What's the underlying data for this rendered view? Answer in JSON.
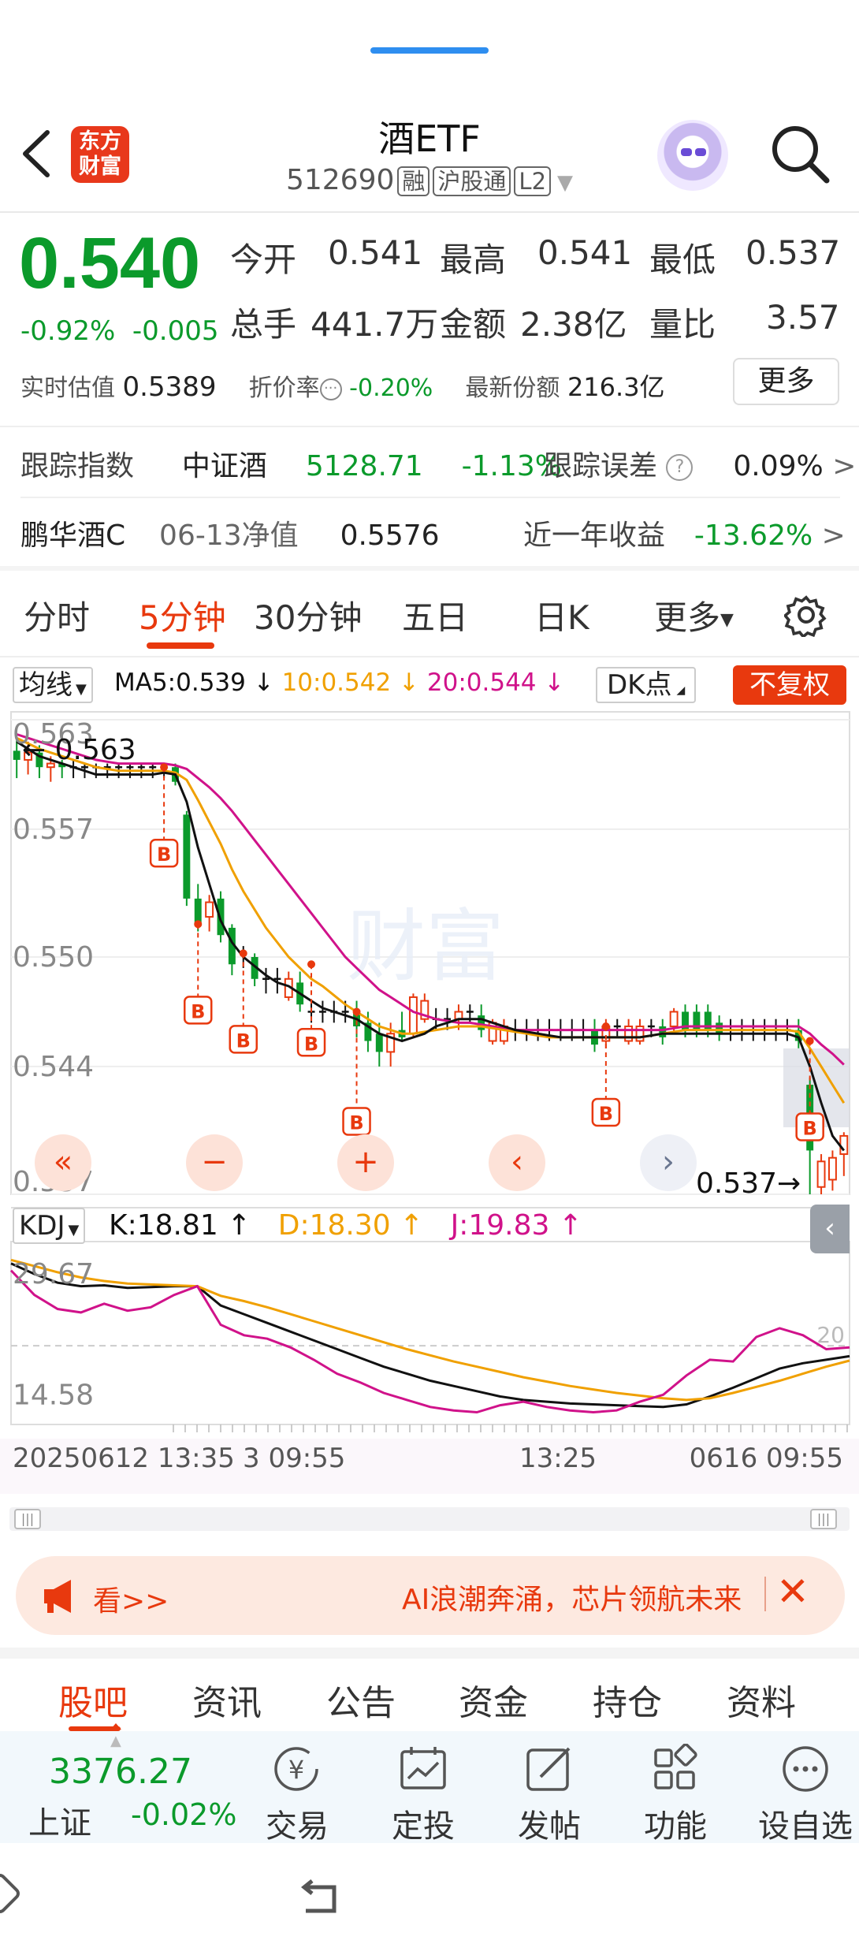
{
  "header": {
    "title": "酒ETF",
    "code": "512690",
    "tags": [
      "融",
      "沪股通",
      "L2"
    ],
    "logo_line1": "东方",
    "logo_line2": "财富"
  },
  "quote": {
    "price": "0.540",
    "change_pct": "-0.92%",
    "change_abs": "-0.005",
    "open_label": "今开",
    "open": "0.541",
    "high_label": "最高",
    "high": "0.541",
    "low_label": "最低",
    "low": "0.537",
    "volume_label": "总手",
    "volume": "441.7万",
    "amount_label": "金额",
    "amount": "2.38亿",
    "ratio_label": "量比",
    "ratio": "3.57",
    "est_label": "实时估值",
    "est_value": "0.5389",
    "discount_label": "折价率",
    "discount_value": "-0.20%",
    "shares_label": "最新份额",
    "shares_value": "216.3亿",
    "more_label": "更多"
  },
  "tracking": {
    "label": "跟踪指数",
    "index_name": "中证酒",
    "index_value": "5128.71",
    "index_change": "-1.13%",
    "error_label": "跟踪误差",
    "error_value": "0.09%",
    "arrow": ">"
  },
  "fund": {
    "name": "鹏华酒C",
    "nav_label": "06-13净值",
    "nav_value": "0.5576",
    "year_label": "近一年收益",
    "year_value": "-13.62%",
    "arrow": ">"
  },
  "tabs": [
    "分时",
    "5分钟",
    "30分钟",
    "五日",
    "日K",
    "更多"
  ],
  "chart_toolbar": {
    "ma_dropdown": "均线",
    "ma5": "MA5:0.539 ↓",
    "ma10": "10:0.542 ↓",
    "ma20": "20:0.544 ↓",
    "dk_label": "DK点",
    "adjust_label": "不复权"
  },
  "chart": {
    "y_ticks": [
      "0.563",
      "0.557",
      "0.550",
      "0.544",
      "0.537"
    ],
    "high_marker": "← 0.563",
    "low_marker": "0.537→",
    "buy_marker": "B",
    "nav_buttons": [
      "«",
      "−",
      "+",
      "‹",
      "›"
    ]
  },
  "kdj": {
    "dropdown": "KDJ",
    "k": "K:18.81 ↑",
    "d": "D:18.30 ↑",
    "j": "J:19.83 ↑",
    "y_ticks": [
      "29.67",
      "14.58"
    ],
    "ref_level": "20"
  },
  "time_axis": [
    "20250612 13:35",
    "3 09:55",
    "13:25",
    "0616 09:55"
  ],
  "banner": {
    "left_text": "看>>",
    "text": "AI浪潮奔涌，芯片领航未来"
  },
  "bottom_tabs": [
    "股吧",
    "资讯",
    "公告",
    "资金",
    "持仓",
    "资料"
  ],
  "bottom_bar": {
    "index_value": "3376.27",
    "index_name": "上证",
    "index_change": "-0.02%",
    "items": [
      "交易",
      "定投",
      "发帖",
      "功能",
      "设自选"
    ]
  },
  "colors": {
    "up": "#e8390e",
    "down": "#0b9a2b",
    "ma5": "#111111",
    "ma10": "#f0a000",
    "ma20": "#d0128a",
    "accent": "#e8390e",
    "link_blue": "#2e8ef0"
  },
  "chart_data": [
    {
      "type": "candlestick",
      "title": "",
      "ylim": [
        0.537,
        0.563
      ],
      "y_ticks": [
        0.563,
        0.557,
        0.55,
        0.544,
        0.537
      ],
      "candles": [
        {
          "o": 0.5613,
          "c": 0.5608,
          "h": 0.562,
          "l": 0.5598
        },
        {
          "o": 0.5608,
          "c": 0.5612,
          "h": 0.5618,
          "l": 0.56
        },
        {
          "o": 0.5612,
          "c": 0.5604,
          "h": 0.5616,
          "l": 0.5598
        },
        {
          "o": 0.5604,
          "c": 0.5606,
          "h": 0.561,
          "l": 0.5596
        },
        {
          "o": 0.5606,
          "c": 0.5604,
          "h": 0.5608,
          "l": 0.5598
        },
        {
          "o": 0.5604,
          "c": 0.5604,
          "h": 0.5608,
          "l": 0.5598
        },
        {
          "o": 0.5604,
          "c": 0.5604,
          "h": 0.5606,
          "l": 0.5598
        },
        {
          "o": 0.5604,
          "c": 0.5604,
          "h": 0.5606,
          "l": 0.5598
        },
        {
          "o": 0.5604,
          "c": 0.5604,
          "h": 0.5606,
          "l": 0.5598
        },
        {
          "o": 0.5604,
          "c": 0.5604,
          "h": 0.5606,
          "l": 0.5598
        },
        {
          "o": 0.5604,
          "c": 0.5604,
          "h": 0.5606,
          "l": 0.5598
        },
        {
          "o": 0.5604,
          "c": 0.5604,
          "h": 0.5606,
          "l": 0.5598
        },
        {
          "o": 0.5604,
          "c": 0.5604,
          "h": 0.5606,
          "l": 0.5598
        },
        {
          "o": 0.5604,
          "c": 0.5604,
          "h": 0.5606,
          "l": 0.5598
        },
        {
          "o": 0.5604,
          "c": 0.5596,
          "h": 0.5606,
          "l": 0.5594
        },
        {
          "o": 0.5578,
          "c": 0.5532,
          "h": 0.558,
          "l": 0.5528
        },
        {
          "o": 0.5532,
          "c": 0.5518,
          "h": 0.554,
          "l": 0.5514
        },
        {
          "o": 0.5522,
          "c": 0.553,
          "h": 0.5534,
          "l": 0.5514
        },
        {
          "o": 0.5532,
          "c": 0.5512,
          "h": 0.5536,
          "l": 0.5508
        },
        {
          "o": 0.5516,
          "c": 0.5496,
          "h": 0.5518,
          "l": 0.549
        },
        {
          "o": 0.5502,
          "c": 0.5502,
          "h": 0.5506,
          "l": 0.5494
        },
        {
          "o": 0.55,
          "c": 0.5488,
          "h": 0.5502,
          "l": 0.5484
        },
        {
          "o": 0.5488,
          "c": 0.5488,
          "h": 0.5494,
          "l": 0.548
        },
        {
          "o": 0.5488,
          "c": 0.5488,
          "h": 0.5494,
          "l": 0.548
        },
        {
          "o": 0.5478,
          "c": 0.5488,
          "h": 0.5492,
          "l": 0.5476
        },
        {
          "o": 0.5486,
          "c": 0.5474,
          "h": 0.5492,
          "l": 0.547
        },
        {
          "o": 0.547,
          "c": 0.547,
          "h": 0.5476,
          "l": 0.5464
        },
        {
          "o": 0.547,
          "c": 0.547,
          "h": 0.5476,
          "l": 0.5464
        },
        {
          "o": 0.547,
          "c": 0.547,
          "h": 0.5476,
          "l": 0.5464
        },
        {
          "o": 0.547,
          "c": 0.547,
          "h": 0.5476,
          "l": 0.5464
        },
        {
          "o": 0.547,
          "c": 0.5462,
          "h": 0.5476,
          "l": 0.5456
        },
        {
          "o": 0.5464,
          "c": 0.5454,
          "h": 0.547,
          "l": 0.5448
        },
        {
          "o": 0.5458,
          "c": 0.5448,
          "h": 0.5464,
          "l": 0.544
        },
        {
          "o": 0.5448,
          "c": 0.5458,
          "h": 0.5464,
          "l": 0.544
        },
        {
          "o": 0.546,
          "c": 0.5456,
          "h": 0.547,
          "l": 0.5454
        },
        {
          "o": 0.5458,
          "c": 0.5478,
          "h": 0.548,
          "l": 0.5456
        },
        {
          "o": 0.5466,
          "c": 0.5476,
          "h": 0.548,
          "l": 0.5464
        },
        {
          "o": 0.5466,
          "c": 0.5466,
          "h": 0.5472,
          "l": 0.546
        },
        {
          "o": 0.5466,
          "c": 0.5466,
          "h": 0.5472,
          "l": 0.546
        },
        {
          "o": 0.5466,
          "c": 0.547,
          "h": 0.5474,
          "l": 0.546
        },
        {
          "o": 0.547,
          "c": 0.547,
          "h": 0.5474,
          "l": 0.5464
        },
        {
          "o": 0.5468,
          "c": 0.546,
          "h": 0.5474,
          "l": 0.5456
        },
        {
          "o": 0.5454,
          "c": 0.5464,
          "h": 0.5466,
          "l": 0.5452
        },
        {
          "o": 0.5454,
          "c": 0.5462,
          "h": 0.5466,
          "l": 0.5452
        },
        {
          "o": 0.546,
          "c": 0.546,
          "h": 0.5466,
          "l": 0.5454
        },
        {
          "o": 0.546,
          "c": 0.546,
          "h": 0.5466,
          "l": 0.5454
        },
        {
          "o": 0.546,
          "c": 0.546,
          "h": 0.5466,
          "l": 0.5454
        },
        {
          "o": 0.546,
          "c": 0.546,
          "h": 0.5466,
          "l": 0.5454
        },
        {
          "o": 0.546,
          "c": 0.546,
          "h": 0.5466,
          "l": 0.5454
        },
        {
          "o": 0.546,
          "c": 0.546,
          "h": 0.5466,
          "l": 0.5454
        },
        {
          "o": 0.546,
          "c": 0.546,
          "h": 0.5466,
          "l": 0.5454
        },
        {
          "o": 0.546,
          "c": 0.5452,
          "h": 0.5466,
          "l": 0.5448
        },
        {
          "o": 0.5454,
          "c": 0.5462,
          "h": 0.5466,
          "l": 0.545
        },
        {
          "o": 0.5462,
          "c": 0.5462,
          "h": 0.5466,
          "l": 0.5456
        },
        {
          "o": 0.5454,
          "c": 0.5462,
          "h": 0.5466,
          "l": 0.5452
        },
        {
          "o": 0.5454,
          "c": 0.5462,
          "h": 0.5466,
          "l": 0.5452
        },
        {
          "o": 0.5462,
          "c": 0.5462,
          "h": 0.5466,
          "l": 0.5456
        },
        {
          "o": 0.5462,
          "c": 0.5456,
          "h": 0.5466,
          "l": 0.5452
        },
        {
          "o": 0.5462,
          "c": 0.547,
          "h": 0.5472,
          "l": 0.5458
        },
        {
          "o": 0.547,
          "c": 0.546,
          "h": 0.5474,
          "l": 0.5456
        },
        {
          "o": 0.547,
          "c": 0.546,
          "h": 0.5474,
          "l": 0.5456
        },
        {
          "o": 0.547,
          "c": 0.546,
          "h": 0.5474,
          "l": 0.5456
        },
        {
          "o": 0.5464,
          "c": 0.5458,
          "h": 0.5468,
          "l": 0.5454
        },
        {
          "o": 0.546,
          "c": 0.546,
          "h": 0.5466,
          "l": 0.5454
        },
        {
          "o": 0.546,
          "c": 0.546,
          "h": 0.5466,
          "l": 0.5454
        },
        {
          "o": 0.546,
          "c": 0.546,
          "h": 0.5466,
          "l": 0.5454
        },
        {
          "o": 0.546,
          "c": 0.546,
          "h": 0.5466,
          "l": 0.5454
        },
        {
          "o": 0.546,
          "c": 0.546,
          "h": 0.5466,
          "l": 0.5454
        },
        {
          "o": 0.546,
          "c": 0.546,
          "h": 0.5466,
          "l": 0.5454
        },
        {
          "o": 0.546,
          "c": 0.5454,
          "h": 0.5466,
          "l": 0.545
        },
        {
          "o": 0.543,
          "c": 0.5394,
          "h": 0.5434,
          "l": 0.537
        },
        {
          "o": 0.5374,
          "c": 0.5388,
          "h": 0.5392,
          "l": 0.537
        },
        {
          "o": 0.5378,
          "c": 0.539,
          "h": 0.5394,
          "l": 0.5372
        },
        {
          "o": 0.5392,
          "c": 0.5402,
          "h": 0.5404,
          "l": 0.538
        }
      ],
      "ma5": [
        0.5618,
        0.5614,
        0.561,
        0.5608,
        0.5606,
        0.5604,
        0.5602,
        0.56,
        0.56,
        0.56,
        0.56,
        0.56,
        0.56,
        0.5601,
        0.56,
        0.5585,
        0.556,
        0.554,
        0.552,
        0.5508,
        0.55,
        0.5495,
        0.549,
        0.5486,
        0.5484,
        0.548,
        0.5476,
        0.5472,
        0.547,
        0.5468,
        0.5466,
        0.5462,
        0.5458,
        0.5456,
        0.5454,
        0.5456,
        0.5458,
        0.5462,
        0.5464,
        0.5466,
        0.5466,
        0.5466,
        0.5464,
        0.5462,
        0.546,
        0.5459,
        0.5458,
        0.5457,
        0.5456,
        0.5456,
        0.5456,
        0.5456,
        0.5456,
        0.5456,
        0.5456,
        0.5456,
        0.5457,
        0.5458,
        0.5458,
        0.5458,
        0.5458,
        0.5458,
        0.5458,
        0.5458,
        0.5458,
        0.5458,
        0.5458,
        0.5458,
        0.5458,
        0.5456,
        0.544,
        0.542,
        0.5402,
        0.5394
      ],
      "ma10": [
        0.562,
        0.5617,
        0.5614,
        0.5612,
        0.561,
        0.5608,
        0.5606,
        0.5604,
        0.5603,
        0.5602,
        0.5602,
        0.5602,
        0.5602,
        0.5602,
        0.5601,
        0.5597,
        0.5586,
        0.5574,
        0.5562,
        0.5548,
        0.5536,
        0.5526,
        0.5516,
        0.5508,
        0.55,
        0.5494,
        0.5488,
        0.5484,
        0.5479,
        0.5474,
        0.547,
        0.5466,
        0.5462,
        0.546,
        0.5458,
        0.5458,
        0.5459,
        0.546,
        0.5461,
        0.5462,
        0.5462,
        0.5462,
        0.5461,
        0.546,
        0.5459,
        0.5458,
        0.5457,
        0.5456,
        0.5456,
        0.5456,
        0.5456,
        0.5456,
        0.5456,
        0.5456,
        0.5456,
        0.5456,
        0.5457,
        0.5458,
        0.5459,
        0.546,
        0.546,
        0.546,
        0.546,
        0.546,
        0.546,
        0.546,
        0.546,
        0.546,
        0.546,
        0.5459,
        0.545,
        0.544,
        0.543,
        0.542
      ],
      "ma20": [
        0.5622,
        0.562,
        0.5618,
        0.5616,
        0.5614,
        0.5612,
        0.561,
        0.5608,
        0.5607,
        0.5606,
        0.5606,
        0.5606,
        0.5606,
        0.5606,
        0.5605,
        0.5603,
        0.5598,
        0.5593,
        0.5587,
        0.558,
        0.5572,
        0.5564,
        0.5556,
        0.5548,
        0.554,
        0.5532,
        0.5524,
        0.5516,
        0.5508,
        0.55,
        0.5494,
        0.5488,
        0.5482,
        0.5478,
        0.5474,
        0.547,
        0.5468,
        0.5466,
        0.5465,
        0.5464,
        0.5464,
        0.5463,
        0.5462,
        0.5461,
        0.546,
        0.546,
        0.546,
        0.546,
        0.546,
        0.546,
        0.546,
        0.546,
        0.546,
        0.546,
        0.546,
        0.546,
        0.546,
        0.546,
        0.5461,
        0.5462,
        0.5462,
        0.5462,
        0.5462,
        0.5462,
        0.5462,
        0.5462,
        0.5462,
        0.5462,
        0.5462,
        0.5462,
        0.5458,
        0.5452,
        0.5447,
        0.5441
      ],
      "buy_signals": [
        {
          "index": 13,
          "price": 0.5604
        },
        {
          "index": 16,
          "price": 0.5518
        },
        {
          "index": 20,
          "price": 0.5502
        },
        {
          "index": 26,
          "price": 0.5496
        },
        {
          "index": 30,
          "price": 0.547
        },
        {
          "index": 52,
          "price": 0.5462
        },
        {
          "index": 70,
          "price": 0.5454
        }
      ]
    },
    {
      "type": "line",
      "title": "KDJ",
      "ylim": [
        11,
        31
      ],
      "y_ticks": [
        29.67,
        14.58
      ],
      "reference_line": 20,
      "series": [
        {
          "name": "K",
          "values": [
            29.4,
            28.2,
            27.2,
            26.8,
            26.9,
            26.6,
            26.7,
            26.8,
            26.8,
            24.6,
            23.6,
            22.6,
            21.6,
            20.6,
            19.6,
            18.6,
            17.6,
            16.8,
            16.0,
            15.4,
            14.8,
            14.2,
            13.8,
            13.6,
            13.4,
            13.3,
            13.2,
            13.1,
            13.0,
            13.3,
            14.2,
            15.2,
            16.3,
            17.4,
            18.0,
            18.4,
            18.8
          ]
        },
        {
          "name": "D",
          "values": [
            29.8,
            29.1,
            28.4,
            27.8,
            27.4,
            27.1,
            27.0,
            26.9,
            26.8,
            25.7,
            25.1,
            24.4,
            23.6,
            22.8,
            22.0,
            21.2,
            20.4,
            19.6,
            18.9,
            18.2,
            17.6,
            17.0,
            16.4,
            15.9,
            15.4,
            15.0,
            14.6,
            14.3,
            14.0,
            13.8,
            14.0,
            14.6,
            15.3,
            16.0,
            16.8,
            17.6,
            18.3
          ]
        },
        {
          "name": "J",
          "values": [
            28.6,
            25.8,
            24.2,
            23.8,
            24.8,
            24.0,
            24.4,
            25.8,
            26.8,
            22.4,
            21.2,
            20.8,
            19.8,
            18.4,
            16.8,
            15.8,
            14.6,
            13.8,
            13.0,
            12.6,
            12.4,
            13.2,
            13.6,
            13.0,
            12.6,
            12.4,
            12.6,
            13.6,
            14.4,
            16.6,
            18.4,
            18.2,
            21.0,
            22.0,
            21.2,
            19.6,
            19.8
          ]
        }
      ]
    }
  ]
}
